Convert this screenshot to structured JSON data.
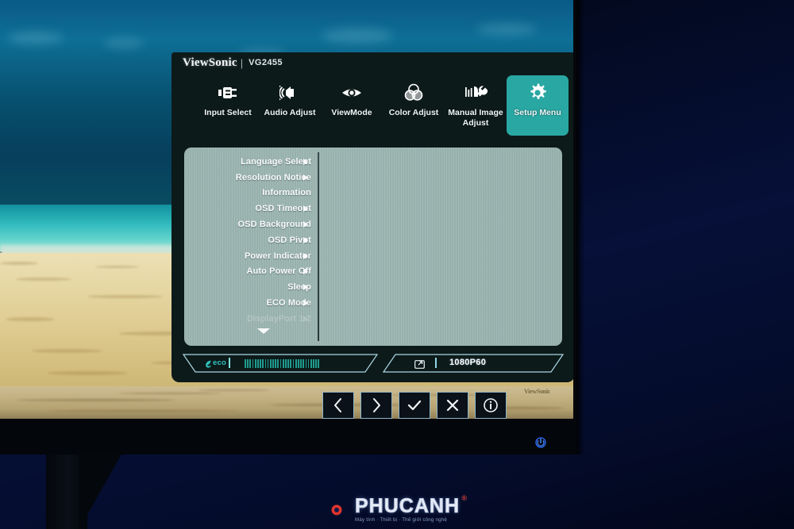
{
  "device": {
    "brand": "ViewSonic",
    "separator": "|",
    "model": "VG2455"
  },
  "nav": {
    "items": [
      {
        "label": "Input Select",
        "icon": "input-plug-icon",
        "active": false
      },
      {
        "label": "Audio Adjust",
        "icon": "speaker-waves-icon",
        "active": false
      },
      {
        "label": "ViewMode",
        "icon": "eye-icon",
        "active": false
      },
      {
        "label": "Color Adjust",
        "icon": "venn-circles-icon",
        "active": false
      },
      {
        "label": "Manual Image Adjust",
        "icon": "sliders-wrench-icon",
        "active": false
      },
      {
        "label": "Setup Menu",
        "icon": "gear-icon",
        "active": true
      }
    ]
  },
  "menu": {
    "items": [
      {
        "label": "Language Select",
        "has_submenu": true,
        "disabled": false
      },
      {
        "label": "Resolution Notice",
        "has_submenu": true,
        "disabled": false
      },
      {
        "label": "Information",
        "has_submenu": false,
        "disabled": false
      },
      {
        "label": "OSD Timeout",
        "has_submenu": true,
        "disabled": false
      },
      {
        "label": "OSD Background",
        "has_submenu": true,
        "disabled": false
      },
      {
        "label": "OSD Pivot",
        "has_submenu": true,
        "disabled": false
      },
      {
        "label": "Power Indicator",
        "has_submenu": true,
        "disabled": false
      },
      {
        "label": "Auto Power Off",
        "has_submenu": true,
        "disabled": false
      },
      {
        "label": "Sleep",
        "has_submenu": true,
        "disabled": false
      },
      {
        "label": "ECO Mode",
        "has_submenu": true,
        "disabled": false
      },
      {
        "label": "DisplayPort 1.2",
        "has_submenu": true,
        "disabled": true
      }
    ],
    "scroll_more_icon": "chevron-down-icon"
  },
  "status_bar": {
    "eco_label": "eco",
    "eco_icon": "eco-leaf-icon",
    "gauge_segments": 30,
    "input_icon": "display-input-icon",
    "resolution": "1080P60"
  },
  "hw_buttons": [
    {
      "icon": "chevron-left-icon",
      "name": "previous-button"
    },
    {
      "icon": "chevron-right-icon",
      "name": "next-button"
    },
    {
      "icon": "check-icon",
      "name": "confirm-button"
    },
    {
      "icon": "close-x-icon",
      "name": "exit-button"
    },
    {
      "icon": "info-circle-icon",
      "name": "info-button"
    }
  ],
  "bezel": {
    "brand_text": "ViewSonic"
  },
  "power": {
    "indicator_icon": "power-icon",
    "indicator_color": "#2b6cff"
  },
  "watermark": {
    "name": "PHUCANH",
    "registered": "®",
    "tagline": "Máy tính · Thiết bị · Thế giới công nghệ",
    "mark_icon": "phucanh-logo-icon"
  },
  "colors": {
    "accent_teal": "#29a8a3",
    "osd_dark": "#0d1a1a",
    "panel_gray": "#9cb6b2",
    "eco_teal": "#2fc4bd",
    "led_blue": "#2b6cff"
  }
}
